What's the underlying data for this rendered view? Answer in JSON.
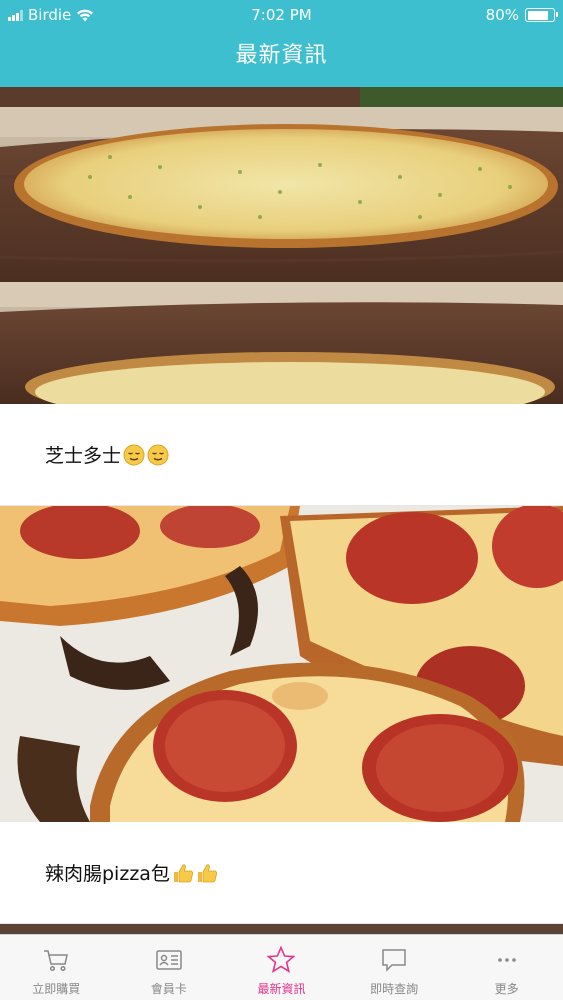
{
  "status_bar": {
    "carrier": "Birdie",
    "time": "7:02 PM",
    "battery": "80%",
    "battery_level": 0.8
  },
  "header": {
    "title": "最新資訊"
  },
  "posts": [
    {
      "caption": "芝士多士",
      "emoji": [
        "relieved-face",
        "relieved-face"
      ]
    },
    {
      "caption": "辣肉腸pizza包",
      "emoji": [
        "thumbs-up",
        "thumbs-up"
      ]
    }
  ],
  "tabs": [
    {
      "label": "立即購買",
      "icon": "cart-icon",
      "active": false
    },
    {
      "label": "會員卡",
      "icon": "member-card-icon",
      "active": false
    },
    {
      "label": "最新資訊",
      "icon": "star-icon",
      "active": true
    },
    {
      "label": "即時查詢",
      "icon": "chat-bubble-icon",
      "active": false
    },
    {
      "label": "更多",
      "icon": "more-dots-icon",
      "active": false
    }
  ],
  "colors": {
    "header_bg": "#3dbfcf",
    "active_tab": "#e8338a",
    "inactive_tab": "#888888"
  }
}
